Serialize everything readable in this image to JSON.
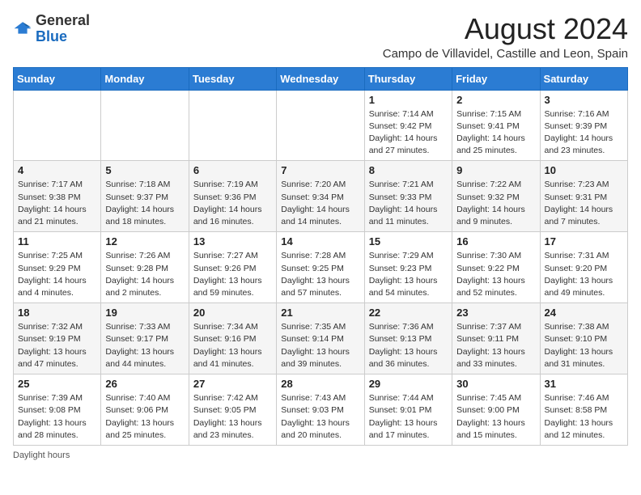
{
  "header": {
    "logo_general": "General",
    "logo_blue": "Blue",
    "month_title": "August 2024",
    "location": "Campo de Villavidel, Castille and Leon, Spain"
  },
  "weekdays": [
    "Sunday",
    "Monday",
    "Tuesday",
    "Wednesday",
    "Thursday",
    "Friday",
    "Saturday"
  ],
  "weeks": [
    [
      {
        "day": "",
        "info": ""
      },
      {
        "day": "",
        "info": ""
      },
      {
        "day": "",
        "info": ""
      },
      {
        "day": "",
        "info": ""
      },
      {
        "day": "1",
        "info": "Sunrise: 7:14 AM\nSunset: 9:42 PM\nDaylight: 14 hours and 27 minutes."
      },
      {
        "day": "2",
        "info": "Sunrise: 7:15 AM\nSunset: 9:41 PM\nDaylight: 14 hours and 25 minutes."
      },
      {
        "day": "3",
        "info": "Sunrise: 7:16 AM\nSunset: 9:39 PM\nDaylight: 14 hours and 23 minutes."
      }
    ],
    [
      {
        "day": "4",
        "info": "Sunrise: 7:17 AM\nSunset: 9:38 PM\nDaylight: 14 hours and 21 minutes."
      },
      {
        "day": "5",
        "info": "Sunrise: 7:18 AM\nSunset: 9:37 PM\nDaylight: 14 hours and 18 minutes."
      },
      {
        "day": "6",
        "info": "Sunrise: 7:19 AM\nSunset: 9:36 PM\nDaylight: 14 hours and 16 minutes."
      },
      {
        "day": "7",
        "info": "Sunrise: 7:20 AM\nSunset: 9:34 PM\nDaylight: 14 hours and 14 minutes."
      },
      {
        "day": "8",
        "info": "Sunrise: 7:21 AM\nSunset: 9:33 PM\nDaylight: 14 hours and 11 minutes."
      },
      {
        "day": "9",
        "info": "Sunrise: 7:22 AM\nSunset: 9:32 PM\nDaylight: 14 hours and 9 minutes."
      },
      {
        "day": "10",
        "info": "Sunrise: 7:23 AM\nSunset: 9:31 PM\nDaylight: 14 hours and 7 minutes."
      }
    ],
    [
      {
        "day": "11",
        "info": "Sunrise: 7:25 AM\nSunset: 9:29 PM\nDaylight: 14 hours and 4 minutes."
      },
      {
        "day": "12",
        "info": "Sunrise: 7:26 AM\nSunset: 9:28 PM\nDaylight: 14 hours and 2 minutes."
      },
      {
        "day": "13",
        "info": "Sunrise: 7:27 AM\nSunset: 9:26 PM\nDaylight: 13 hours and 59 minutes."
      },
      {
        "day": "14",
        "info": "Sunrise: 7:28 AM\nSunset: 9:25 PM\nDaylight: 13 hours and 57 minutes."
      },
      {
        "day": "15",
        "info": "Sunrise: 7:29 AM\nSunset: 9:23 PM\nDaylight: 13 hours and 54 minutes."
      },
      {
        "day": "16",
        "info": "Sunrise: 7:30 AM\nSunset: 9:22 PM\nDaylight: 13 hours and 52 minutes."
      },
      {
        "day": "17",
        "info": "Sunrise: 7:31 AM\nSunset: 9:20 PM\nDaylight: 13 hours and 49 minutes."
      }
    ],
    [
      {
        "day": "18",
        "info": "Sunrise: 7:32 AM\nSunset: 9:19 PM\nDaylight: 13 hours and 47 minutes."
      },
      {
        "day": "19",
        "info": "Sunrise: 7:33 AM\nSunset: 9:17 PM\nDaylight: 13 hours and 44 minutes."
      },
      {
        "day": "20",
        "info": "Sunrise: 7:34 AM\nSunset: 9:16 PM\nDaylight: 13 hours and 41 minutes."
      },
      {
        "day": "21",
        "info": "Sunrise: 7:35 AM\nSunset: 9:14 PM\nDaylight: 13 hours and 39 minutes."
      },
      {
        "day": "22",
        "info": "Sunrise: 7:36 AM\nSunset: 9:13 PM\nDaylight: 13 hours and 36 minutes."
      },
      {
        "day": "23",
        "info": "Sunrise: 7:37 AM\nSunset: 9:11 PM\nDaylight: 13 hours and 33 minutes."
      },
      {
        "day": "24",
        "info": "Sunrise: 7:38 AM\nSunset: 9:10 PM\nDaylight: 13 hours and 31 minutes."
      }
    ],
    [
      {
        "day": "25",
        "info": "Sunrise: 7:39 AM\nSunset: 9:08 PM\nDaylight: 13 hours and 28 minutes."
      },
      {
        "day": "26",
        "info": "Sunrise: 7:40 AM\nSunset: 9:06 PM\nDaylight: 13 hours and 25 minutes."
      },
      {
        "day": "27",
        "info": "Sunrise: 7:42 AM\nSunset: 9:05 PM\nDaylight: 13 hours and 23 minutes."
      },
      {
        "day": "28",
        "info": "Sunrise: 7:43 AM\nSunset: 9:03 PM\nDaylight: 13 hours and 20 minutes."
      },
      {
        "day": "29",
        "info": "Sunrise: 7:44 AM\nSunset: 9:01 PM\nDaylight: 13 hours and 17 minutes."
      },
      {
        "day": "30",
        "info": "Sunrise: 7:45 AM\nSunset: 9:00 PM\nDaylight: 13 hours and 15 minutes."
      },
      {
        "day": "31",
        "info": "Sunrise: 7:46 AM\nSunset: 8:58 PM\nDaylight: 13 hours and 12 minutes."
      }
    ]
  ],
  "footnote": "Daylight hours"
}
